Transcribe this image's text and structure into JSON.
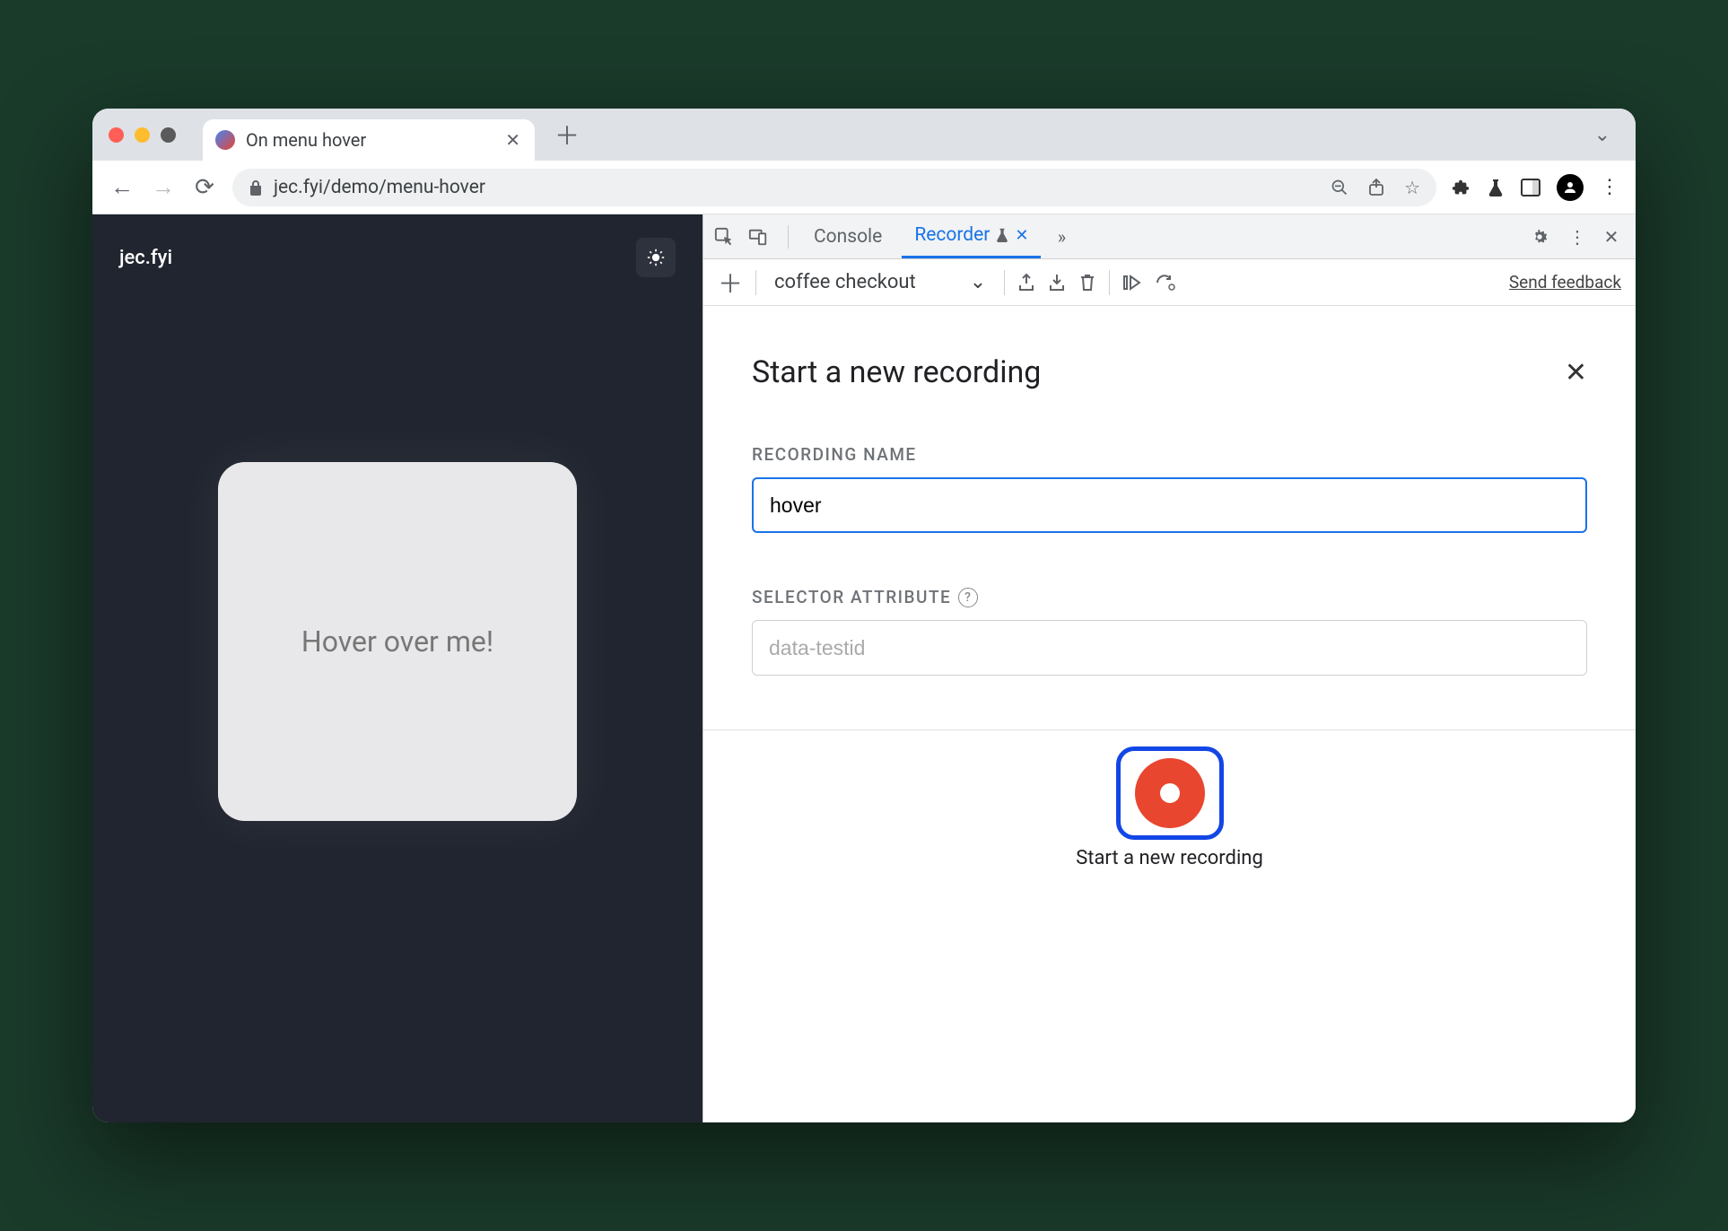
{
  "browser": {
    "tab_title": "On menu hover",
    "url": "jec.fyi/demo/menu-hover"
  },
  "page": {
    "brand": "jec.fyi",
    "card_text": "Hover over me!"
  },
  "devtools": {
    "tabs": {
      "console": "Console",
      "recorder": "Recorder"
    },
    "toolbar": {
      "recording_select": "coffee checkout",
      "feedback": "Send feedback"
    },
    "recorder": {
      "heading": "Start a new recording",
      "name_label": "RECORDING NAME",
      "name_value": "hover",
      "selector_label": "SELECTOR ATTRIBUTE",
      "selector_placeholder": "data-testid",
      "start_button_label": "Start a new recording"
    }
  }
}
